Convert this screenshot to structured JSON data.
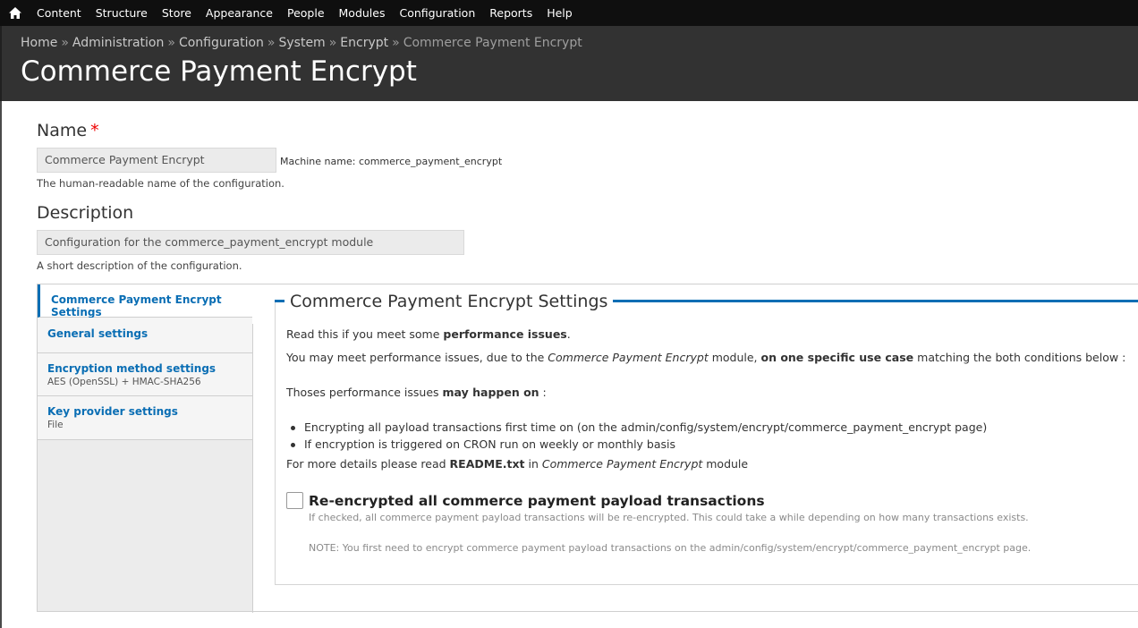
{
  "toolbar": {
    "home_icon": "home-icon",
    "items": [
      "Content",
      "Structure",
      "Store",
      "Appearance",
      "People",
      "Modules",
      "Configuration",
      "Reports",
      "Help"
    ]
  },
  "breadcrumb": {
    "items": [
      "Home",
      "Administration",
      "Configuration",
      "System",
      "Encrypt"
    ],
    "separator": "»",
    "current": "Commerce Payment Encrypt"
  },
  "page_title": "Commerce Payment Encrypt",
  "form": {
    "name_label": "Name",
    "required_mark": "*",
    "name_value": "Commerce Payment Encrypt",
    "machine_name": "Machine name: commerce_payment_encrypt",
    "name_help": "The human-readable name of the configuration.",
    "description_label": "Description",
    "description_value": "Configuration for the commerce_payment_encrypt module",
    "description_help": "A short description of the configuration."
  },
  "vertical_tabs": [
    {
      "title": "Commerce Payment Encrypt Settings",
      "summary": "",
      "active": true
    },
    {
      "title": "General settings",
      "summary": "",
      "active": false
    },
    {
      "title": "Encryption method settings",
      "summary": "AES (OpenSSL) + HMAC-SHA256",
      "active": false
    },
    {
      "title": "Key provider settings",
      "summary": "File",
      "active": false
    }
  ],
  "pane": {
    "legend": "Commerce Payment Encrypt Settings",
    "p1_a": "Read this if you meet some ",
    "p1_b": "performance issues",
    "p1_c": ".",
    "p2_a": "You may meet performance issues, due to the ",
    "p2_b": "Commerce Payment Encrypt",
    "p2_c": " module, ",
    "p2_d": "on one specific use case",
    "p2_e": " matching the both conditions below :",
    "p3_a": "Thoses performance issues ",
    "p3_b": "may happen on",
    "p3_c": " :",
    "bullets": [
      "Encrypting all payload transactions first time on (on the admin/config/system/encrypt/commerce_payment_encrypt page)",
      "If encryption is triggered on CRON run on weekly or monthly basis"
    ],
    "p4_a": "For more details please read ",
    "p4_b": "README.txt",
    "p4_c": " in ",
    "p4_d": "Commerce Payment Encrypt",
    "p4_e": " module",
    "checkbox_label": "Re-encrypted all commerce payment payload transactions",
    "checkbox_checked": false,
    "checkbox_desc": "If checked, all commerce payment payload transactions will be re-encrypted. This could take a while depending on how many transactions exists.",
    "note": "NOTE: You first need to encrypt commerce payment payload transactions on the admin/config/system/encrypt/commerce_payment_encrypt page."
  },
  "colors": {
    "toolbar_bg": "#0f0f0f",
    "header_bg": "#323232",
    "accent": "#0a6eb4",
    "required": "#ee0000"
  }
}
